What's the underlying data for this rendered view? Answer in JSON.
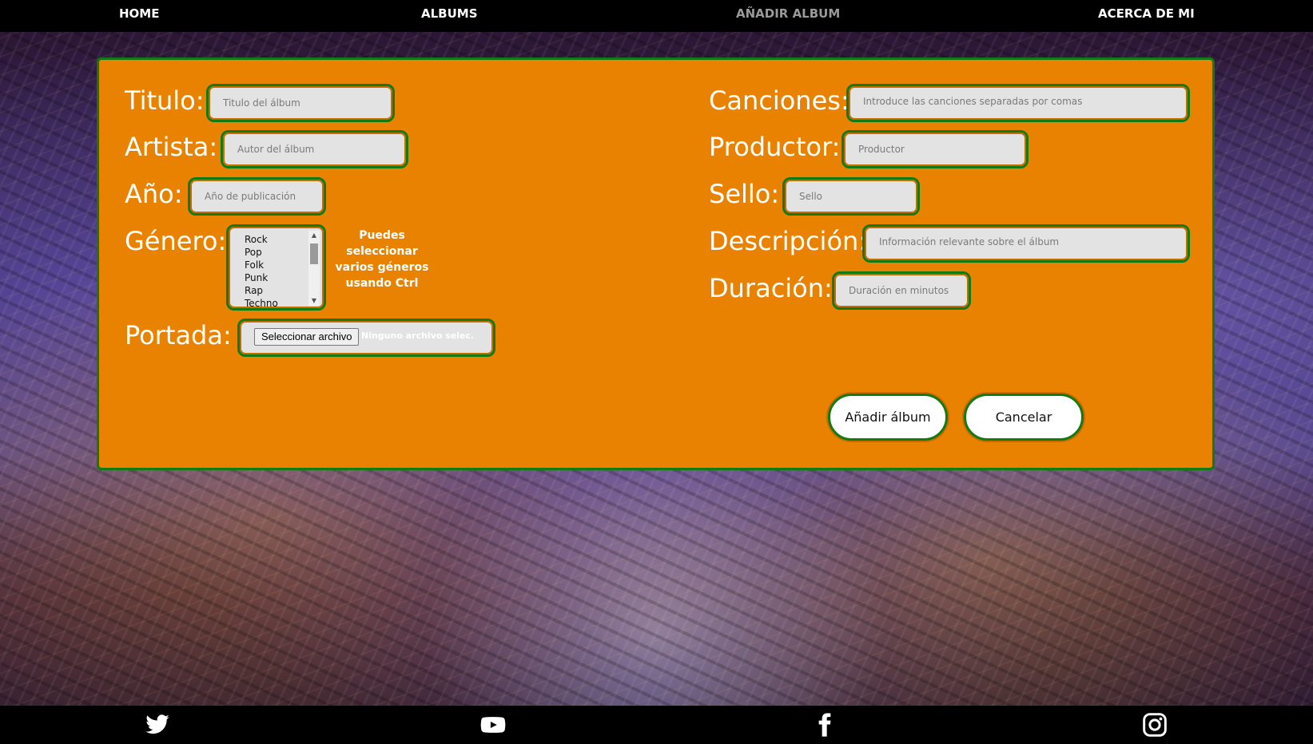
{
  "nav": {
    "items": [
      {
        "label": "HOME",
        "active": false
      },
      {
        "label": "ALBUMS",
        "active": false
      },
      {
        "label": "AÑADIR ALBUM",
        "active": true
      },
      {
        "label": "ACERCA DE MI",
        "active": false
      }
    ]
  },
  "form": {
    "titulo": {
      "label": "Titulo:",
      "placeholder": "Titulo del álbum"
    },
    "artista": {
      "label": "Artista:",
      "placeholder": "Autor del álbum"
    },
    "anio": {
      "label": "Año:",
      "placeholder": "Año de publicación"
    },
    "genero": {
      "label": "Género:",
      "options": [
        "Rock",
        "Pop",
        "Folk",
        "Punk",
        "Rap",
        "Techno"
      ],
      "hint": "Puedes seleccionar varios géneros usando Ctrl"
    },
    "portada": {
      "label": "Portada:",
      "button_label": "Seleccionar archivo",
      "status": "Ninguno archivo selec."
    },
    "canciones": {
      "label": "Canciones:",
      "placeholder": "Introduce las canciones separadas por comas"
    },
    "productor": {
      "label": "Productor:",
      "placeholder": "Productor"
    },
    "sello": {
      "label": "Sello:",
      "placeholder": "Sello"
    },
    "descripcion": {
      "label": "Descripción:",
      "placeholder": "Información relevante sobre el álbum"
    },
    "duracion": {
      "label": "Duración:",
      "placeholder": "Duración en minutos"
    },
    "submit_label": "Añadir álbum",
    "cancel_label": "Cancelar"
  },
  "footer": {
    "icons": [
      "twitter-icon",
      "youtube-icon",
      "facebook-icon",
      "instagram-icon"
    ]
  },
  "colors": {
    "card_bg": "#e88200",
    "border": "#127a12",
    "nav_bg": "#000000",
    "active_nav": "#9a9a9a"
  }
}
